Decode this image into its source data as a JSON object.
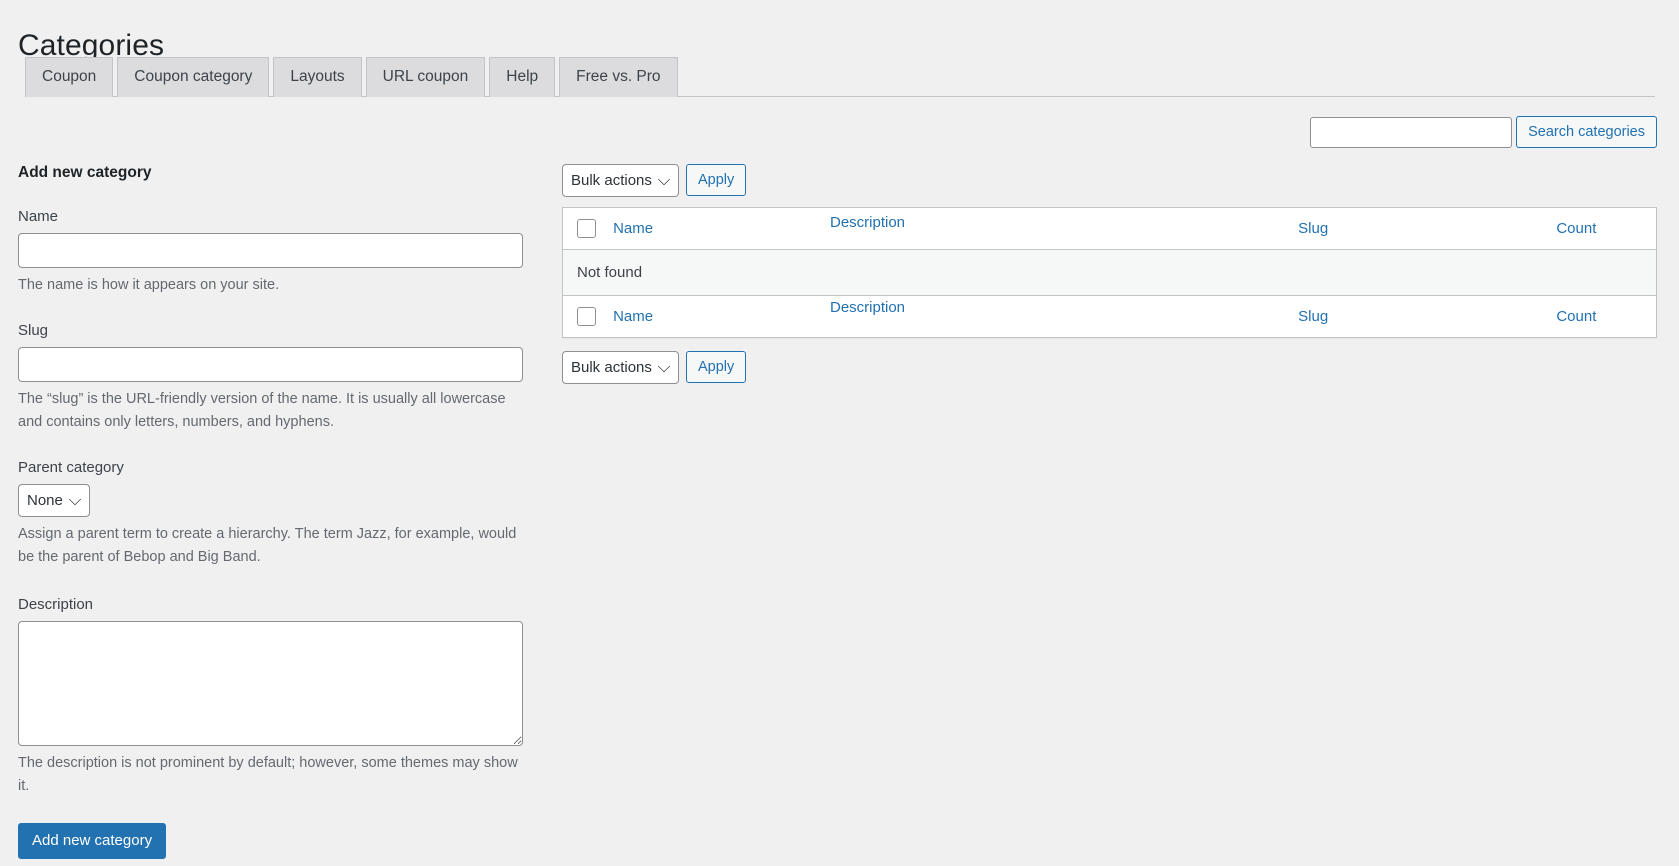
{
  "page": {
    "title": "Categories"
  },
  "tabs": [
    {
      "label": "Coupon",
      "name": "tab-coupon"
    },
    {
      "label": "Coupon category",
      "name": "tab-coupon-category"
    },
    {
      "label": "Layouts",
      "name": "tab-layouts"
    },
    {
      "label": "URL coupon",
      "name": "tab-url-coupon"
    },
    {
      "label": "Help",
      "name": "tab-help"
    },
    {
      "label": "Free vs. Pro",
      "name": "tab-free-vs-pro"
    }
  ],
  "search": {
    "value": "",
    "placeholder": "",
    "button_label": "Search categories"
  },
  "form": {
    "heading": "Add new category",
    "name": {
      "label": "Name",
      "value": "",
      "placeholder": "",
      "help": "The name is how it appears on your site."
    },
    "slug": {
      "label": "Slug",
      "value": "",
      "placeholder": "",
      "help": "The “slug” is the URL-friendly version of the name. It is usually all lowercase and contains only letters, numbers, and hyphens."
    },
    "parent": {
      "label": "Parent category",
      "selected": "None",
      "options": [
        "None"
      ],
      "help": "Assign a parent term to create a hierarchy. The term Jazz, for example, would be the parent of Bebop and Big Band."
    },
    "description": {
      "label": "Description",
      "value": "",
      "placeholder": "",
      "help": "The description is not prominent by default; however, some themes may show it."
    },
    "submit_label": "Add new category"
  },
  "tablenav": {
    "bulk_selected": "Bulk actions",
    "bulk_options": [
      "Bulk actions"
    ],
    "apply_label": "Apply"
  },
  "table": {
    "columns": {
      "name": "Name",
      "description": "Description",
      "slug": "Slug",
      "count": "Count"
    },
    "rows": [],
    "empty_message": "Not found"
  },
  "colors": {
    "accent": "#2271b1",
    "page_bg": "#f0f0f1",
    "tab_bg": "#dcdcde",
    "border": "#c3c4c7",
    "text": "#3c434a",
    "muted_text": "#646970"
  }
}
